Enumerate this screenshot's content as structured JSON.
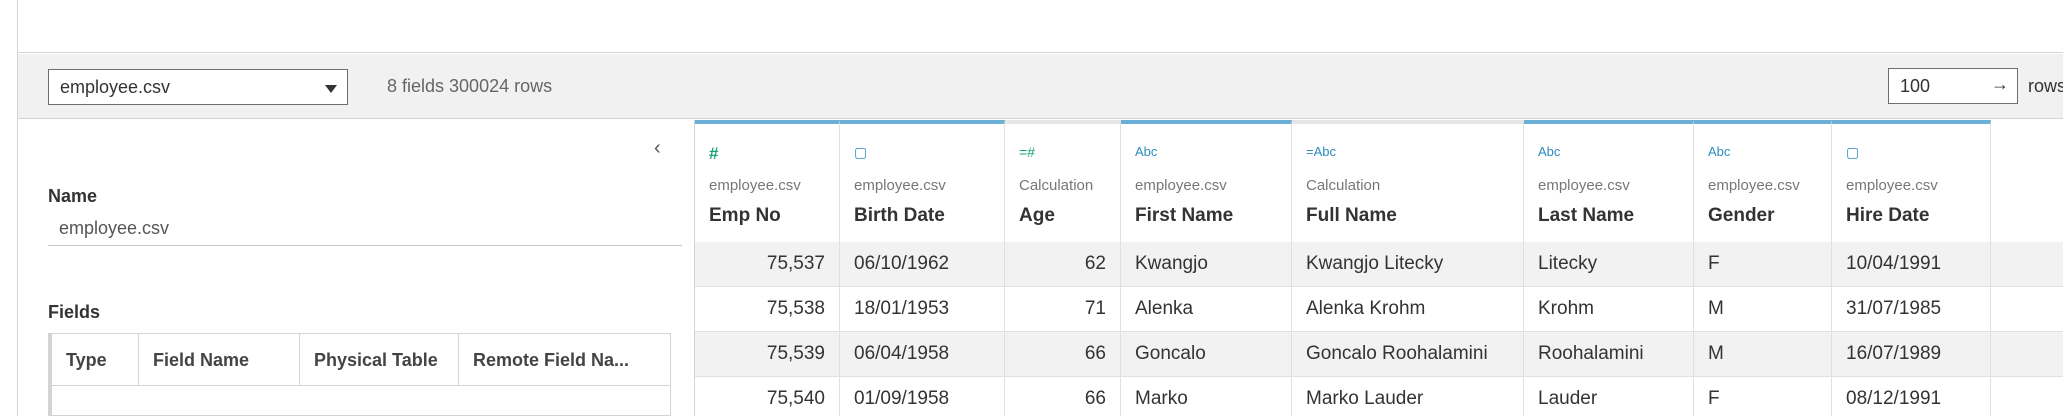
{
  "toolbar": {
    "data_source": "employee.csv",
    "summary": "8 fields 300024 rows",
    "rows_value": "100",
    "rows_label": "rows",
    "arrow": "→"
  },
  "left_panel": {
    "collapse_glyph": "‹",
    "name_label": "Name",
    "name_value": "employee.csv",
    "fields_label": "Fields",
    "fields_columns": [
      "Type",
      "Field Name",
      "Physical Table",
      "Remote Field Na..."
    ]
  },
  "grid": {
    "columns": [
      {
        "icon": "number-icon",
        "glyph": "#",
        "source": "employee.csv",
        "name": "Emp No",
        "calc": false
      },
      {
        "icon": "date-icon",
        "glyph": "▢",
        "source": "employee.csv",
        "name": "Birth Date",
        "calc": false
      },
      {
        "icon": "calculated-number-icon",
        "glyph": "=#",
        "source": "Calculation",
        "name": "Age",
        "calc": true
      },
      {
        "icon": "string-icon",
        "glyph": "Abc",
        "source": "employee.csv",
        "name": "First Name",
        "calc": false
      },
      {
        "icon": "calculated-string-icon",
        "glyph": "=Abc",
        "source": "Calculation",
        "name": "Full Name",
        "calc": true
      },
      {
        "icon": "string-icon",
        "glyph": "Abc",
        "source": "employee.csv",
        "name": "Last Name",
        "calc": false
      },
      {
        "icon": "string-icon",
        "glyph": "Abc",
        "source": "employee.csv",
        "name": "Gender",
        "calc": false
      },
      {
        "icon": "date-icon",
        "glyph": "▢",
        "source": "employee.csv",
        "name": "Hire Date",
        "calc": false
      }
    ],
    "rows": [
      [
        "75,537",
        "06/10/1962",
        "62",
        "Kwangjo",
        "Kwangjo Litecky",
        "Litecky",
        "F",
        "10/04/1991"
      ],
      [
        "75,538",
        "18/01/1953",
        "71",
        "Alenka",
        "Alenka Krohm",
        "Krohm",
        "M",
        "31/07/1985"
      ],
      [
        "75,539",
        "06/04/1958",
        "66",
        "Goncalo",
        "Goncalo Roohalamini",
        "Roohalamini",
        "M",
        "16/07/1989"
      ],
      [
        "75,540",
        "01/09/1958",
        "66",
        "Marko",
        "Marko Lauder",
        "Lauder",
        "F",
        "08/12/1991"
      ]
    ]
  },
  "colors": {
    "header_accent": "#6baed6",
    "number_icon": "#1aa37a",
    "string_icon": "#2b8cbe",
    "toolbar_bg": "#f1f1f1"
  }
}
